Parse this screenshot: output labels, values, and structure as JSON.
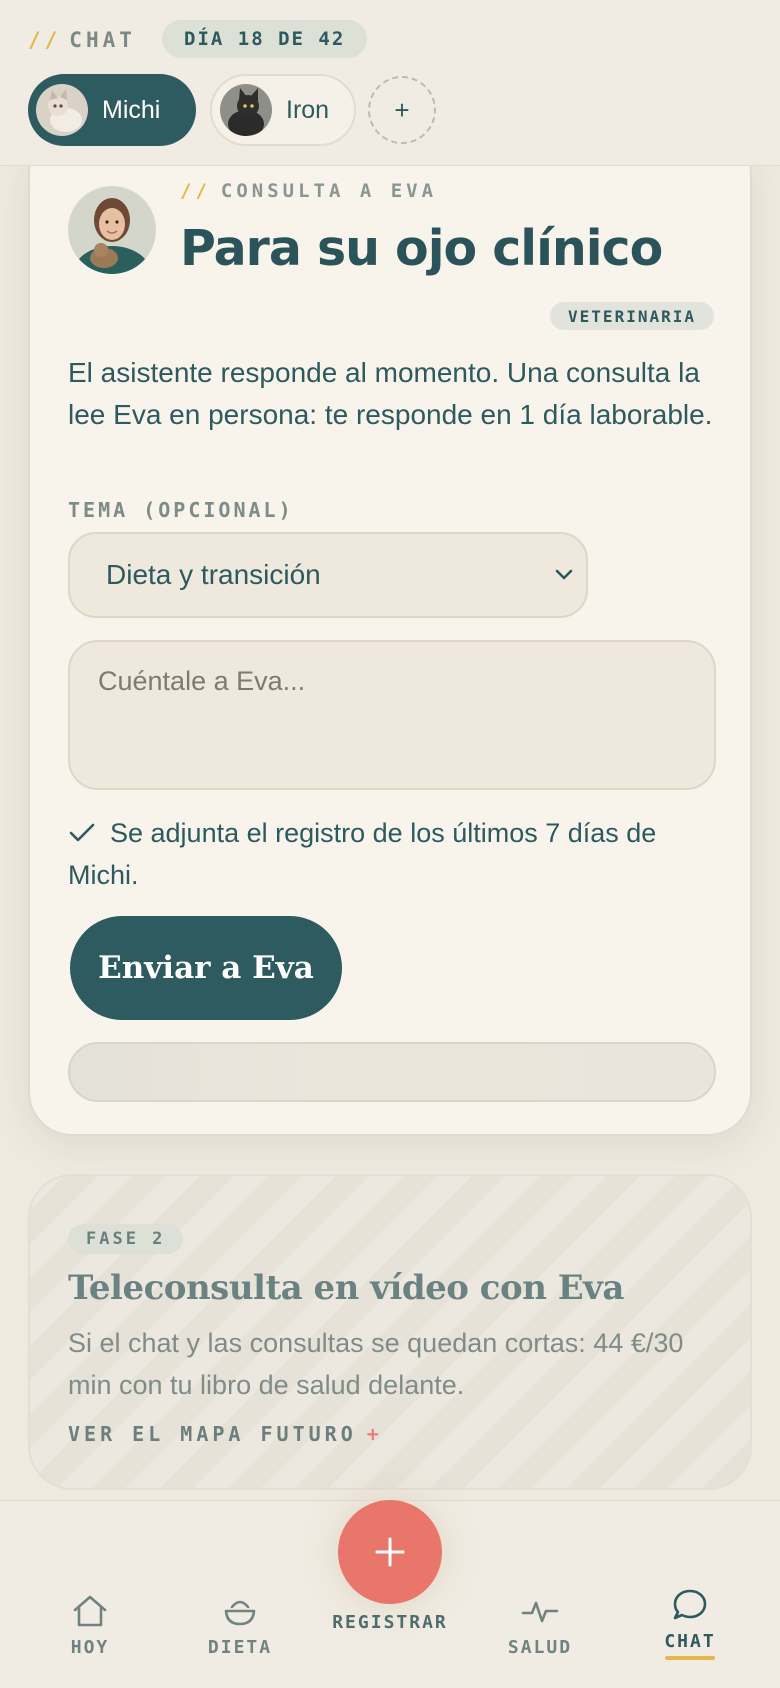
{
  "header": {
    "section_label": "CHAT",
    "day_counter": "DÍA 18 DE 42",
    "pets": [
      {
        "name": "Michi",
        "active": true
      },
      {
        "name": "Iron",
        "active": false
      }
    ],
    "add_label": "+"
  },
  "consult_card": {
    "eyebrow": "CONSULTA A EVA",
    "title": "Para su ojo clínico",
    "badge": "VETERINARIA",
    "description": "El asistente responde al momento. Una consulta la lee Eva en persona: te responde en 1 día laborable.",
    "topic_label": "TEMA (OPCIONAL)",
    "topic_selected": "Dieta y transición",
    "message_placeholder": "Cuéntale a Eva...",
    "attach_note": "Se adjunta el registro de los últimos 7 días de Michi.",
    "send_label": "Enviar a Eva"
  },
  "phase_card": {
    "badge": "FASE 2",
    "title": "Teleconsulta en vídeo con Eva",
    "description": "Si el chat y las consultas se quedan cortas: 44 €/30 min con tu libro de salud delante.",
    "link": "VER EL MAPA FUTURO",
    "link_icon": "+"
  },
  "bottom_nav": {
    "items": [
      {
        "label": "HOY",
        "icon": "home-icon"
      },
      {
        "label": "DIETA",
        "icon": "bowl-icon"
      },
      {
        "label": "SALUD",
        "icon": "pulse-icon"
      },
      {
        "label": "CHAT",
        "icon": "chat-bubble-icon",
        "active": true
      }
    ],
    "fab_label": "REGISTRAR",
    "fab_icon": "+"
  },
  "colors": {
    "primary": "#2d5b60",
    "accent_yellow": "#e5b74a",
    "accent_coral": "#e8766b",
    "background": "#efe9df"
  }
}
